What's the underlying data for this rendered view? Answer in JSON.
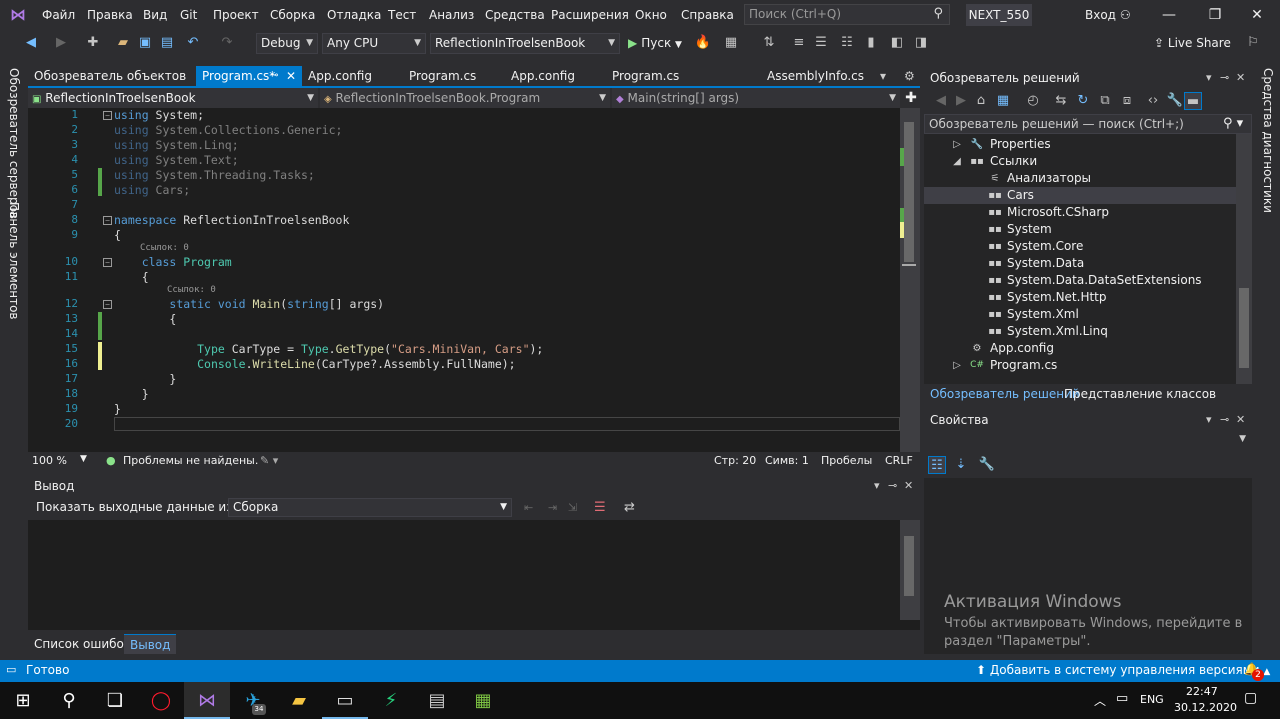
{
  "menu": {
    "items": [
      "Файл",
      "Правка",
      "Вид",
      "Git",
      "Проект",
      "Сборка",
      "Отладка",
      "Тест",
      "Анализ",
      "Средства",
      "Расширения",
      "Окно",
      "Справка"
    ],
    "search_placeholder": "Поиск (Ctrl+Q)",
    "solution_name": "NEXT_550",
    "login_label": "Вход"
  },
  "toolbar": {
    "config": "Debug",
    "platform": "Any CPU",
    "startup_project": "ReflectionInTroelsenBook",
    "run_label": "Пуск",
    "liveshare_label": "Live Share"
  },
  "left_strip": {
    "server_explorer": "Обозреватель серверов",
    "toolbox": "Панель элементов"
  },
  "editor_tabs": [
    {
      "label": "Обозреватель объектов"
    },
    {
      "label": "Program.cs*"
    },
    {
      "label": "App.config"
    },
    {
      "label": "Program.cs"
    },
    {
      "label": "App.config"
    },
    {
      "label": "Program.cs"
    },
    {
      "label": "AssemblyInfo.cs"
    }
  ],
  "navbar": {
    "project": "ReflectionInTroelsenBook",
    "type": "ReflectionInTroelsenBook.Program",
    "member": "Main(string[] args)"
  },
  "code": {
    "refs_label": "Ссылок: 0",
    "line_numbers": [
      "1",
      "2",
      "3",
      "4",
      "5",
      "6",
      "7",
      "8",
      "9",
      "10",
      "11",
      "12",
      "13",
      "14",
      "15",
      "16",
      "17",
      "18",
      "19",
      "20"
    ]
  },
  "editor_status": {
    "zoom": "100 %",
    "problems": "Проблемы не найдены.",
    "line": "Стр: 20",
    "col": "Симв: 1",
    "spaces": "Пробелы",
    "eol": "CRLF"
  },
  "output": {
    "title": "Вывод",
    "show_label": "Показать выходные данные из:",
    "source": "Сборка"
  },
  "bottom_tabs": [
    "Список ошибок",
    "Вывод"
  ],
  "solution_explorer": {
    "title": "Обозреватель решений",
    "search_placeholder": "Обозреватель решений — поиск (Ctrl+;)",
    "tree": [
      {
        "label": "Properties"
      },
      {
        "label": "Ссылки"
      },
      {
        "label": "Анализаторы"
      },
      {
        "label": "Cars"
      },
      {
        "label": "Microsoft.CSharp"
      },
      {
        "label": "System"
      },
      {
        "label": "System.Core"
      },
      {
        "label": "System.Data"
      },
      {
        "label": "System.Data.DataSetExtensions"
      },
      {
        "label": "System.Net.Http"
      },
      {
        "label": "System.Xml"
      },
      {
        "label": "System.Xml.Linq"
      },
      {
        "label": "App.config"
      },
      {
        "label": "Program.cs"
      }
    ],
    "tabs": [
      "Обозреватель решений",
      "Представление классов"
    ]
  },
  "properties": {
    "title": "Свойства"
  },
  "right_strip": {
    "diagnostics": "Средства диагностики"
  },
  "watermark": {
    "title": "Активация Windows",
    "line1": "Чтобы активировать Windows, перейдите в",
    "line2": "раздел \"Параметры\"."
  },
  "statusbar": {
    "ready": "Готово",
    "vcs": "Добавить в систему управления версиями",
    "notifications": "2"
  },
  "taskbar": {
    "lang": "ENG",
    "time": "22:47",
    "date": "30.12.2020",
    "telegram_badge": "34"
  }
}
